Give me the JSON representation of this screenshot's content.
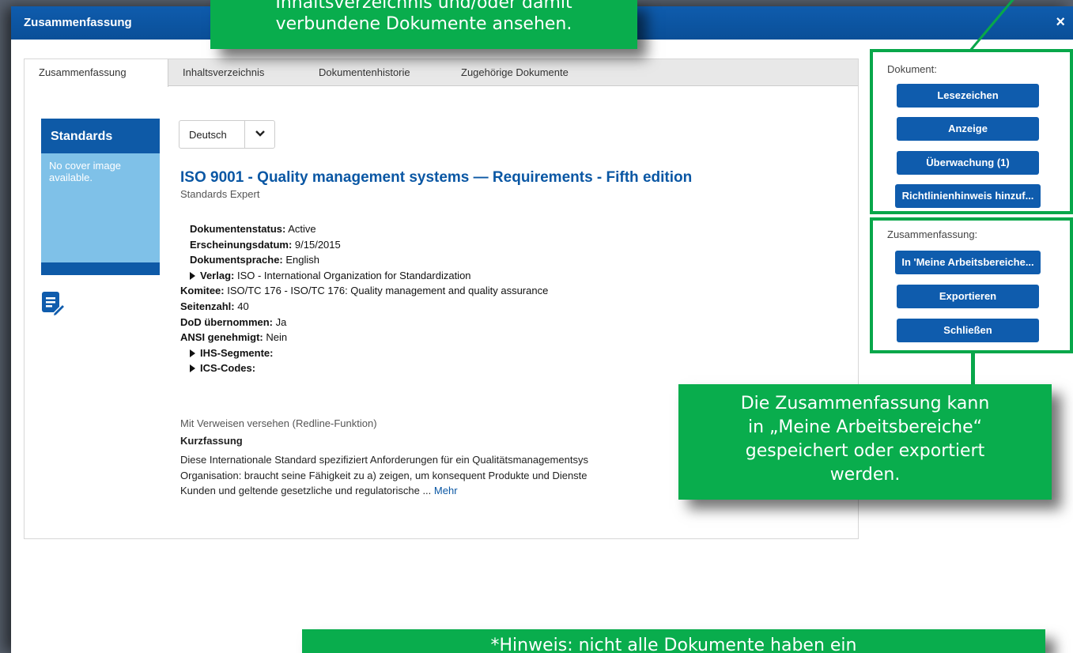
{
  "window": {
    "title": "Zusammenfassung",
    "close_label": "×"
  },
  "tabs": [
    {
      "label": "Zusammenfassung"
    },
    {
      "label": "Inhaltsverzeichnis"
    },
    {
      "label": "Dokumentenhistorie"
    },
    {
      "label": "Zugehörige Dokumente"
    }
  ],
  "cover": {
    "heading": "Standards",
    "no_image": "No cover image available."
  },
  "language": {
    "selected": "Deutsch"
  },
  "document": {
    "title": "ISO 9001 - Quality management systems — Requirements - Fifth edition",
    "subtitle": "Standards Expert",
    "fields": [
      {
        "label": "Dokumentenstatus:",
        "value": " Active"
      },
      {
        "label": "Erscheinungsdatum:",
        "value": " 9/15/2015"
      },
      {
        "label": "Dokumentsprache:",
        "value": " English"
      },
      {
        "label": "Verlag:",
        "value": " ISO - International Organization for Standardization"
      },
      {
        "label": "Komitee:",
        "value": " ISO/TC 176 - ISO/TC 176: Quality management and quality assurance"
      },
      {
        "label": "Seitenzahl:",
        "value": " 40"
      },
      {
        "label": "DoD übernommen:",
        "value": " Ja"
      },
      {
        "label": "ANSI genehmigt:",
        "value": " Nein"
      },
      {
        "label": "IHS-Segmente:",
        "value": ""
      },
      {
        "label": "ICS-Codes:",
        "value": ""
      }
    ],
    "redline": "Mit Verweisen versehen (Redline-Funktion)",
    "abstract_heading": "Kurzfassung",
    "abstract_lines": [
      "Diese Internationale Standard spezifiziert Anforderungen für ein Qualitätsmanagementsys",
      "Organisation: braucht seine Fähigkeit zu a) zeigen, um konsequent Produkte und Dienste",
      "Kunden und geltende gesetzliche und regulatorische ... "
    ],
    "more_link": "Mehr"
  },
  "sidebar": {
    "document_label": "Dokument:",
    "document_buttons": [
      "Lesezeichen",
      "Anzeige",
      "Überwachung (1)",
      "Richtlinienhinweis hinzuf..."
    ],
    "summary_label": "Zusammenfassung:",
    "summary_buttons": [
      "In 'Meine Arbeitsbereiche...",
      "Exportieren",
      "Schließen"
    ]
  },
  "callouts": {
    "top_lines": [
      "Inhaltsverzeichnis und/oder damit",
      "verbundene Dokumente ansehen."
    ],
    "right_lines": [
      "Die Zusammenfassung kann",
      "in „Meine Arbeitsbereiche“",
      "gespeichert oder exportiert",
      "werden."
    ],
    "bottom_line": "*Hinweis: nicht alle Dokumente haben ein"
  },
  "colors": {
    "brand_blue": "#0f5cad",
    "callout_green": "#09ad4d"
  }
}
